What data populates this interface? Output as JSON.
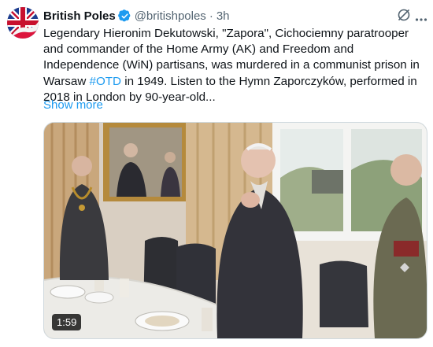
{
  "author": {
    "display_name": "British Poles",
    "handle": "@britishpoles",
    "separator": "·",
    "time": "3h"
  },
  "tweet": {
    "text_before_hashtag": "Legendary Hieronim Dekutowski, \"Zapora\", Cichociemny paratrooper and commander of the Home Army (AK) and Freedom and Independence (WiN) partisans, was murdered in a communist prison in Warsaw ",
    "hashtag": "#OTD",
    "text_after_hashtag": " in 1949. Listen to the Hymn Zaporczyków, performed in 2018 in London by 90-year-old...",
    "show_more": "Show more"
  },
  "video": {
    "duration": "1:59"
  },
  "icons": {
    "verified": "verified-badge-icon",
    "grok": "grok-icon",
    "more": "more-options-icon"
  },
  "colors": {
    "link": "#1d9bf0",
    "verified": "#1d9bf0",
    "secondary_text": "#536471"
  }
}
